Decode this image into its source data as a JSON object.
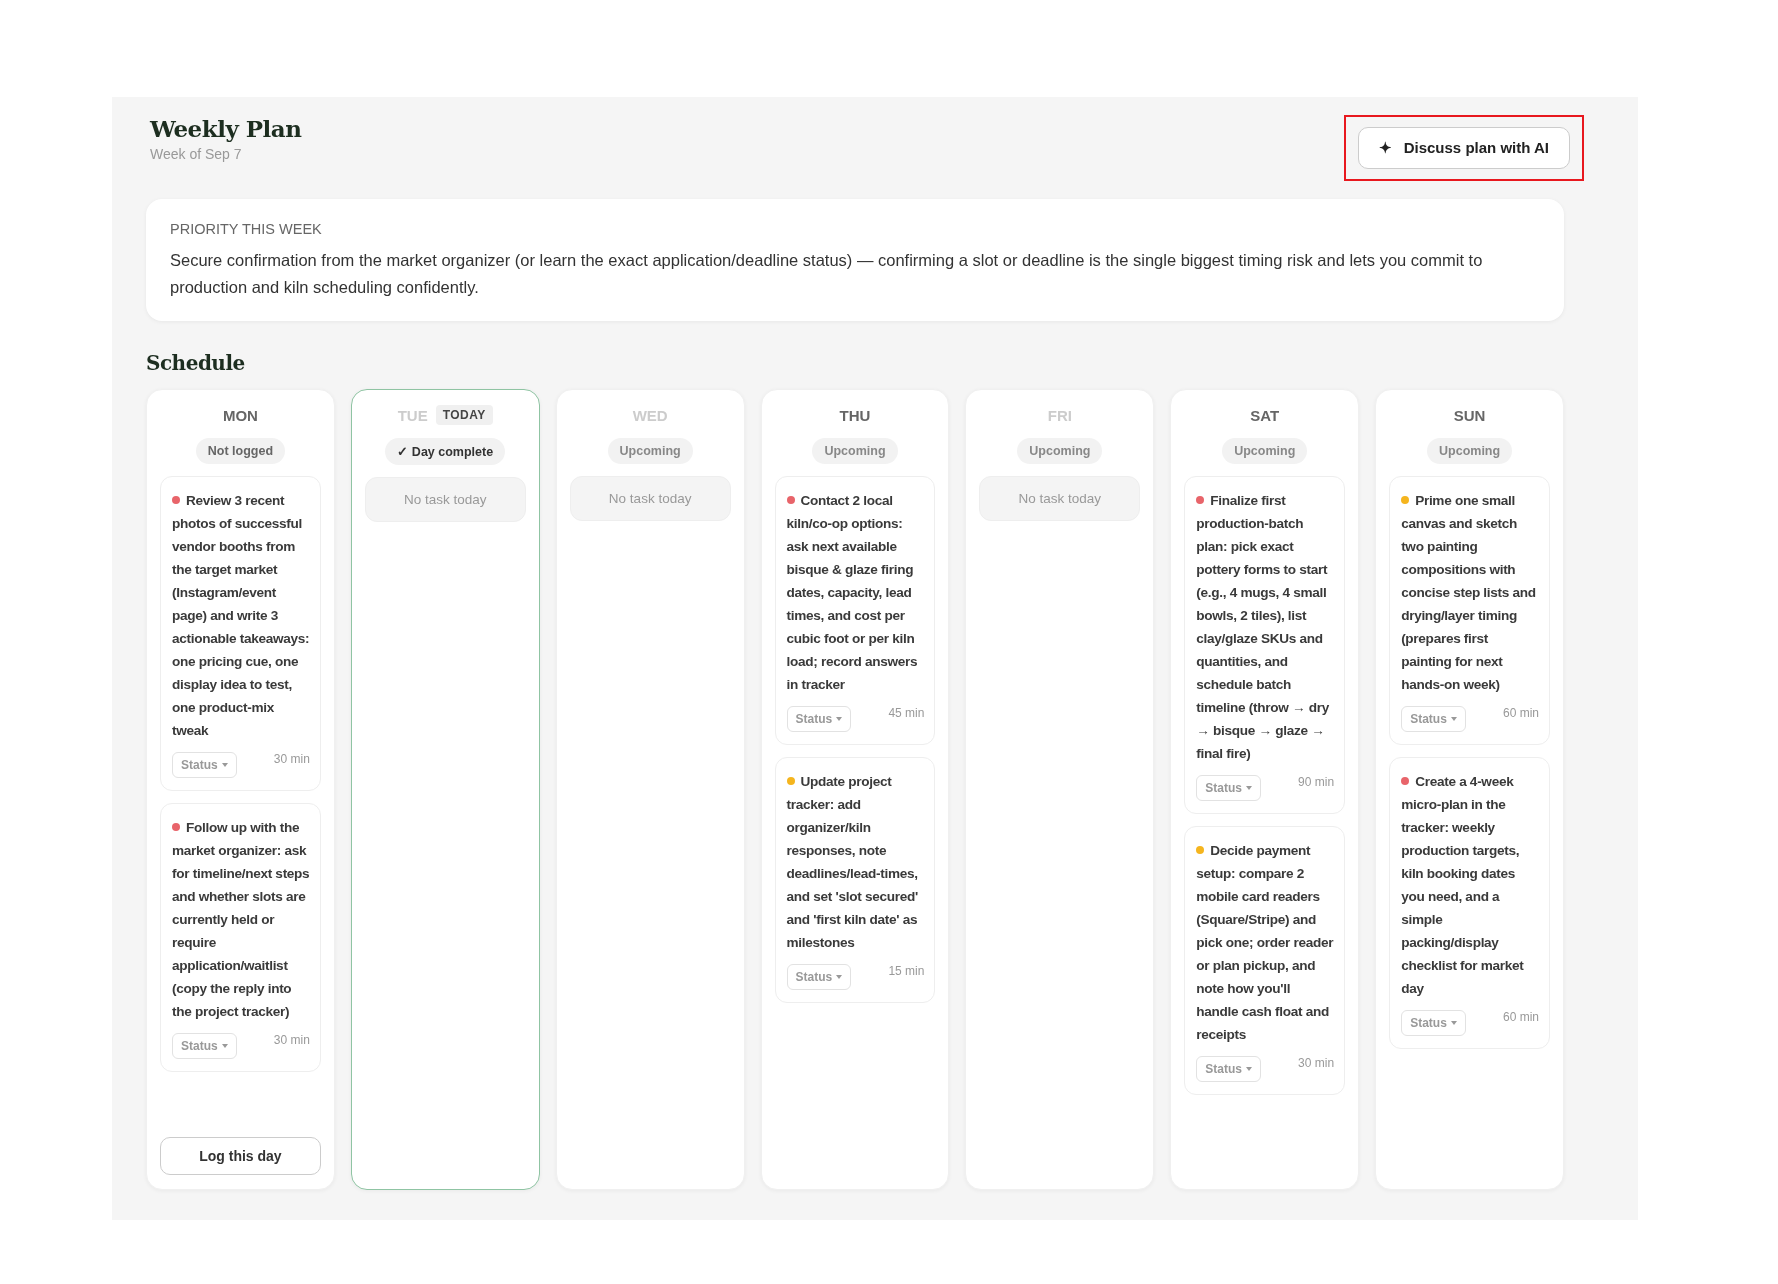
{
  "header": {
    "title": "Weekly Plan",
    "subtitle": "Week of Sep 7",
    "action": {
      "icon": "✦",
      "label": "Discuss plan with AI",
      "highlighted": true
    }
  },
  "priority": {
    "heading": "PRIORITY THIS WEEK",
    "text": "Secure confirmation from the market organizer (or learn the exact application/deadline status) — confirming a slot or deadline is the single biggest timing risk and lets you commit to production and kiln scheduling confidently."
  },
  "schedule": {
    "heading": "Schedule",
    "days": [
      {
        "name": "MON",
        "dimmed": false,
        "today": false,
        "status": {
          "kind": "not_logged",
          "label": "Not logged"
        },
        "tasks": [
          {
            "color": "#e8646a",
            "title": "Review 3 recent photos of successful vendor booths from the target market (Instagram/event page) and write 3 actionable takeaways: one pricing cue, one display idea to test, one product-mix tweak",
            "status": "Status",
            "duration": "30 min"
          },
          {
            "color": "#e8646a",
            "title": "Follow up with the market organizer: ask for timeline/next steps and whether slots are currently held or require application/waitlist (copy the reply into the project tracker)",
            "status": "Status",
            "duration": "30 min"
          }
        ],
        "log_button": "Log this day"
      },
      {
        "name": "TUE",
        "dimmed": true,
        "today": true,
        "today_badge": "TODAY",
        "status": {
          "kind": "complete",
          "label": "✓ Day complete"
        },
        "empty_text": "No task today"
      },
      {
        "name": "WED",
        "dimmed": true,
        "today": false,
        "status": {
          "kind": "upcoming",
          "label": "Upcoming"
        },
        "empty_text": "No task today"
      },
      {
        "name": "THU",
        "dimmed": false,
        "today": false,
        "status": {
          "kind": "upcoming",
          "label": "Upcoming"
        },
        "tasks": [
          {
            "color": "#e8646a",
            "title": "Contact 2 local kiln/co-op options: ask next available bisque & glaze firing dates, capacity, lead times, and cost per cubic foot or per kiln load; record answers in tracker",
            "status": "Status",
            "duration": "45 min"
          },
          {
            "color": "#f5b51e",
            "title": "Update project tracker: add organizer/kiln responses, note deadlines/lead-times, and set 'slot secured' and 'first kiln date' as milestones",
            "status": "Status",
            "duration": "15 min"
          }
        ]
      },
      {
        "name": "FRI",
        "dimmed": true,
        "today": false,
        "status": {
          "kind": "upcoming",
          "label": "Upcoming"
        },
        "empty_text": "No task today"
      },
      {
        "name": "SAT",
        "dimmed": false,
        "today": false,
        "status": {
          "kind": "upcoming",
          "label": "Upcoming"
        },
        "tasks": [
          {
            "color": "#e8646a",
            "title": "Finalize first production-batch plan: pick exact pottery forms to start (e.g., 4 mugs, 4 small bowls, 2 tiles), list clay/glaze SKUs and quantities, and schedule batch timeline (throw → dry → bisque → glaze → final fire)",
            "status": "Status",
            "duration": "90 min"
          },
          {
            "color": "#f5b51e",
            "title": "Decide payment setup: compare 2 mobile card readers (Square/Stripe) and pick one; order reader or plan pickup, and note how you'll handle cash float and receipts",
            "status": "Status",
            "duration": "30 min"
          }
        ]
      },
      {
        "name": "SUN",
        "dimmed": false,
        "today": false,
        "status": {
          "kind": "upcoming",
          "label": "Upcoming"
        },
        "tasks": [
          {
            "color": "#f5b51e",
            "title": "Prime one small canvas and sketch two painting compositions with concise step lists and drying/layer timing (prepares first painting for next hands-on week)",
            "status": "Status",
            "duration": "60 min"
          },
          {
            "color": "#e8646a",
            "title": "Create a 4-week micro-plan in the tracker: weekly production targets, kiln booking dates you need, and a simple packing/display checklist for market day",
            "status": "Status",
            "duration": "60 min"
          }
        ]
      }
    ]
  }
}
